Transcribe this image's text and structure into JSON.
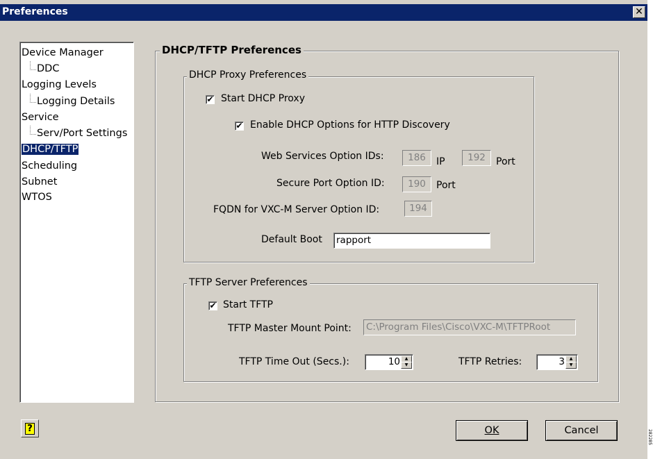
{
  "window": {
    "title": "Preferences",
    "close_glyph": "✕"
  },
  "tree": {
    "items": [
      {
        "label": "Device Manager",
        "level": 0
      },
      {
        "label": "DDC",
        "level": 1
      },
      {
        "label": "Logging Levels",
        "level": 0
      },
      {
        "label": "Logging Details",
        "level": 1
      },
      {
        "label": "Service",
        "level": 0
      },
      {
        "label": "Serv/Port Settings",
        "level": 1
      },
      {
        "label": "DHCP/TFTP",
        "level": 0,
        "selected": true
      },
      {
        "label": "Scheduling",
        "level": 0
      },
      {
        "label": "Subnet",
        "level": 0
      },
      {
        "label": "WTOS",
        "level": 0
      }
    ]
  },
  "panel": {
    "title": "DHCP/TFTP Preferences"
  },
  "dhcp": {
    "group_title": "DHCP Proxy Preferences",
    "start_proxy_label": "Start DHCP Proxy",
    "start_proxy_checked": true,
    "enable_options_label": "Enable DHCP Options for HTTP Discovery",
    "enable_options_checked": true,
    "web_services_label": "Web Services Option IDs:",
    "web_ip_value": "186",
    "ip_label": "IP",
    "web_port_value": "192",
    "port_label": "Port",
    "secure_port_label": "Secure Port Option ID:",
    "secure_port_value": "190",
    "secure_port_unit": "Port",
    "fqdn_label": "FQDN for VXC-M Server Option ID:",
    "fqdn_value": "194",
    "default_boot_label": "Default Boot",
    "default_boot_value": "rapport"
  },
  "tftp": {
    "group_title": "TFTP Server Preferences",
    "start_label": "Start TFTP",
    "start_checked": true,
    "mount_label": "TFTP Master Mount Point:",
    "mount_value": "C:\\Program Files\\Cisco\\VXC-M\\TFTPRoot",
    "timeout_label": "TFTP Time Out (Secs.):",
    "timeout_value": "10",
    "retries_label": "TFTP Retries:",
    "retries_value": "3"
  },
  "footer": {
    "help_glyph": "?",
    "ok_label": "OK",
    "cancel_label": "Cancel"
  },
  "side_code": "282285"
}
